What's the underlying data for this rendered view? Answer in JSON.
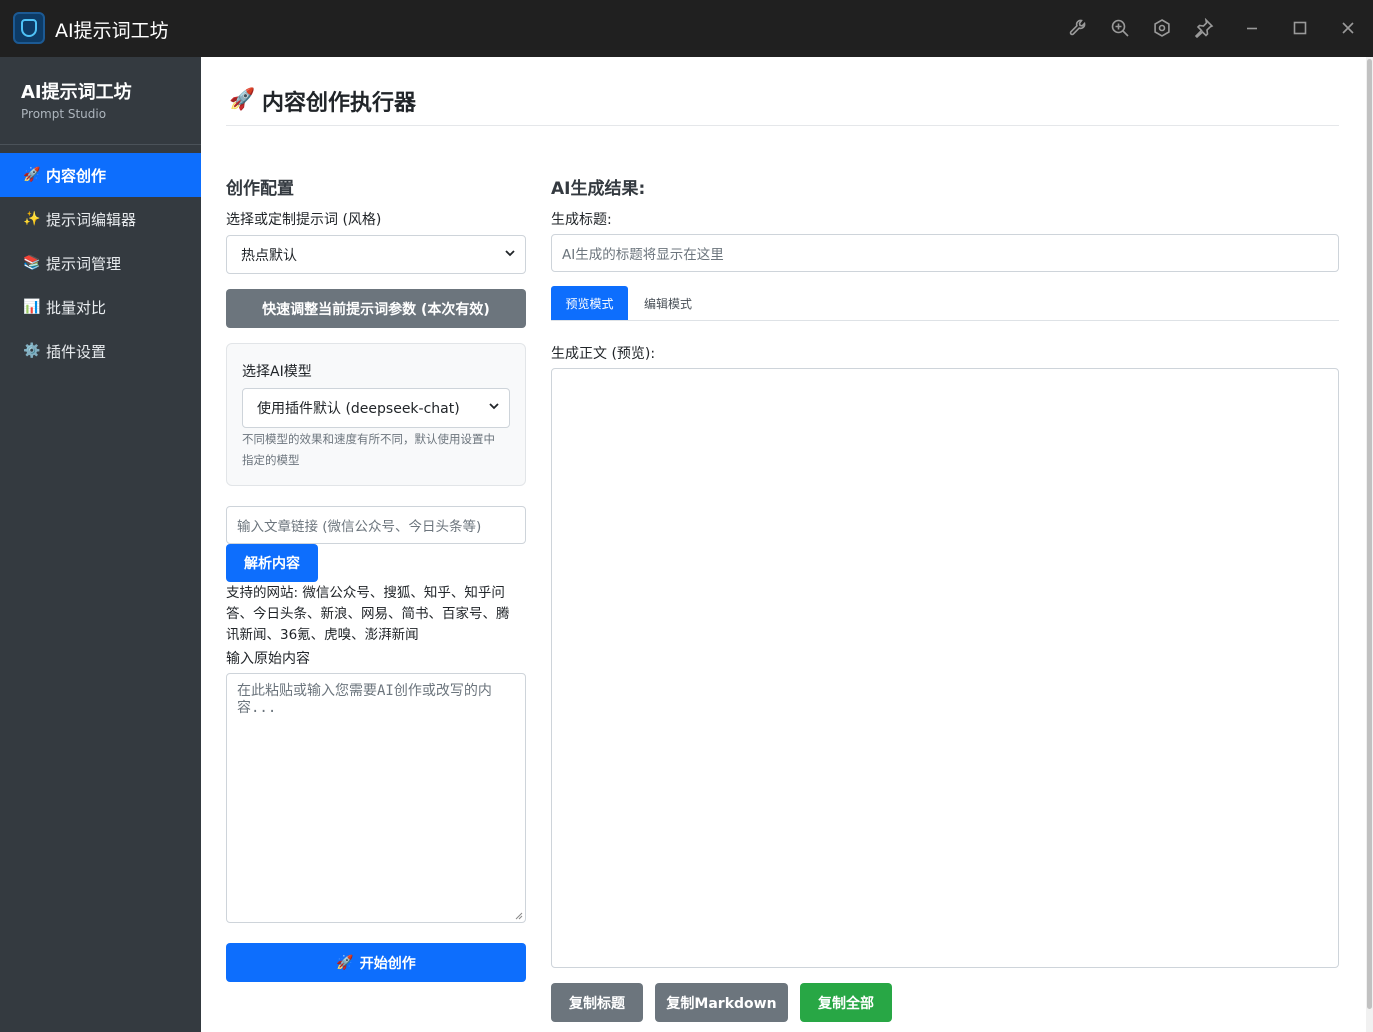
{
  "window": {
    "title": "AI提示词工坊"
  },
  "sidebar": {
    "brand_title": "AI提示词工坊",
    "brand_subtitle": "Prompt Studio",
    "items": [
      {
        "icon": "🚀",
        "label": "内容创作",
        "active": true
      },
      {
        "icon": "✨",
        "label": "提示词编辑器",
        "active": false
      },
      {
        "icon": "📚",
        "label": "提示词管理",
        "active": false
      },
      {
        "icon": "📊",
        "label": "批量对比",
        "active": false
      },
      {
        "icon": "⚙️",
        "label": "插件设置",
        "active": false
      }
    ]
  },
  "page": {
    "icon": "🚀",
    "title": "内容创作执行器"
  },
  "config": {
    "section_title": "创作配置",
    "style_label": "选择或定制提示词 (风格)",
    "style_value": "热点默认",
    "adjust_button": "快速调整当前提示词参数 (本次有效)",
    "model_label": "选择AI模型",
    "model_value": "使用插件默认 (deepseek-chat)",
    "model_help_line1": "不同模型的效果和速度有所不同，默认使用设置中",
    "model_help_line2": "指定的模型",
    "url_placeholder": "输入文章链接 (微信公众号、今日头条等)",
    "parse_button": "解析内容",
    "support_line1": "支持的网站: 微信公众号、搜狐、知乎、知乎问",
    "support_line2": "答、今日头条、新浪、网易、简书、百家号、腾",
    "support_line3": "讯新闻、36氪、虎嗅、澎湃新闻",
    "raw_label": "输入原始内容",
    "raw_placeholder_line1": "在此粘贴或输入您需要AI创作或改写的内",
    "raw_placeholder_line2": "容...",
    "start_button_icon": "🚀",
    "start_button": "开始创作"
  },
  "result": {
    "section_title": "AI生成结果:",
    "title_label": "生成标题:",
    "title_placeholder": "AI生成的标题将显示在这里",
    "tabs": [
      {
        "label": "预览模式",
        "active": true
      },
      {
        "label": "编辑模式",
        "active": false
      }
    ],
    "body_label": "生成正文 (预览):",
    "copy_title_button": "复制标题",
    "copy_markdown_button": "复制Markdown",
    "copy_all_button": "复制全部"
  },
  "colors": {
    "primary": "#0d6efd",
    "secondary": "#6c757d",
    "success": "#28a745",
    "sidebar_bg": "#343a40",
    "titlebar_bg": "#202020"
  }
}
